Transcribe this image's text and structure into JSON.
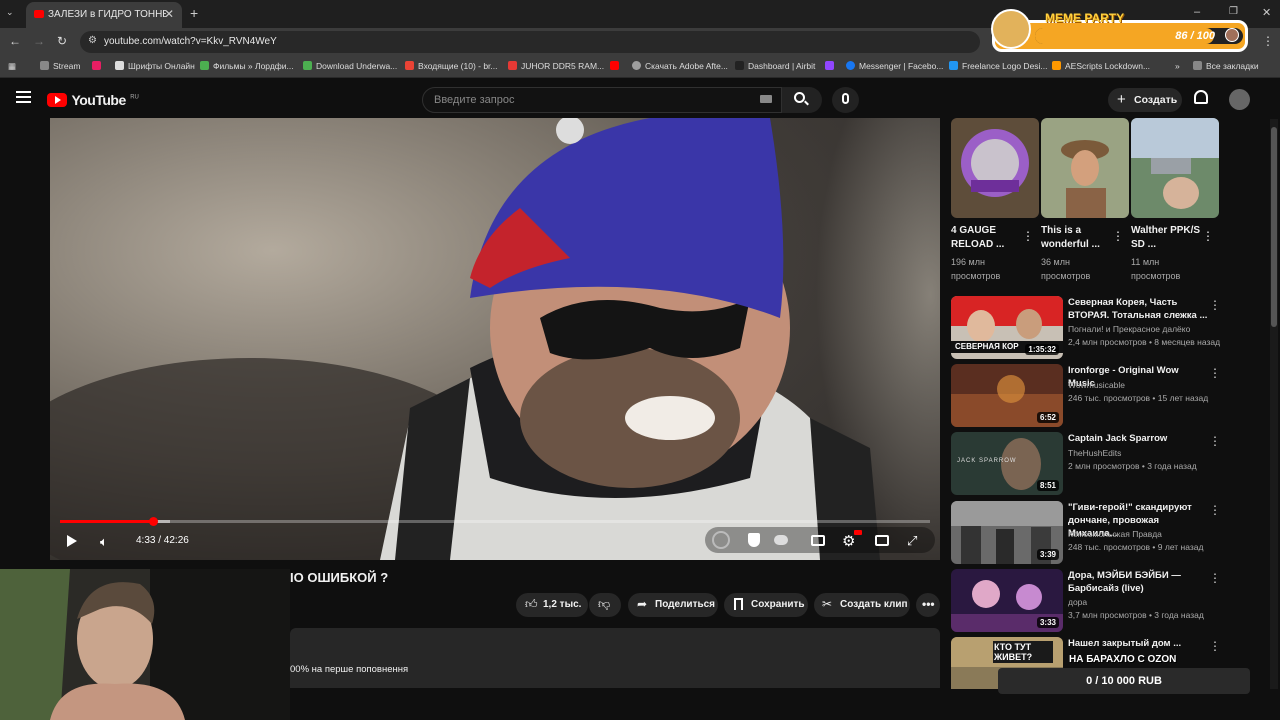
{
  "browser": {
    "tab_title": "ЗАЛЕЗИ в ГИДРО ТОННЕЛЬ ! З",
    "url": "youtube.com/watch?v=Kkv_RVN4WeY",
    "bookmarks": [
      "Stream",
      "Шрифты Онлайн",
      "Фильмы » Лордфи...",
      "Download Underwa...",
      "Входящие (10) - br...",
      "JUHOR DDR5 RAM...",
      "Скачать Adobe Afte...",
      "Dashboard | Airbit",
      "Messenger | Facebo...",
      "Freelance Logo Desi...",
      "AEScripts Lockdown...",
      "Все закладки"
    ],
    "bookmark_colors": [
      "#888",
      "#e91e63",
      "#ddd",
      "#4caf50",
      "#4caf50",
      "#ea4335",
      "#e53935",
      "#ff0000",
      "#9e9e9e",
      "#222",
      "#9146ff",
      "#1877f2",
      "#2196f3",
      "#ff9800"
    ]
  },
  "meme_widget": {
    "label": "MEME PARTY",
    "progress_text": "86 / 100",
    "progress_fraction": 0.86
  },
  "youtube": {
    "logo_text": "YouTube",
    "region": "RU",
    "search_placeholder": "Введите запрос",
    "create_label": "Создать"
  },
  "player": {
    "time": "4:33 / 42:26",
    "progress_fraction": 0.107,
    "buffer_fraction": 0.127
  },
  "video_info": {
    "title_fragment": "ІО ОШИБКОЙ ?",
    "likes": "1,2 тыс.",
    "share": "Поделиться",
    "save": "Сохранить",
    "clip": "Создать клип",
    "description_fragment": "00% на перше поповнення"
  },
  "shorts": [
    {
      "title": "4 GAUGE RELOAD ...",
      "views": "196 млн просмотров"
    },
    {
      "title": "This is a wonderful ...",
      "views": "36 млн просмотров"
    },
    {
      "title": "Walther PPK/S SD ...",
      "views": "11 млн просмотров"
    }
  ],
  "recommendations": [
    {
      "title": "Северная Корея, Часть ВТОРАЯ. Тотальная слежка ...",
      "channel": "Погнали! и Прекрасное далёко",
      "meta": "2,4 млн просмотров • 8 месяцев назад",
      "duration": "1:35:32",
      "thumb_text": "СЕВЕРНАЯ КОР"
    },
    {
      "title": "Ironforge - Original Wow Music",
      "channel": "Wowmusicable",
      "meta": "246 тыс. просмотров • 15 лет назад",
      "duration": "6:52",
      "thumb_text": ""
    },
    {
      "title": "Captain Jack Sparrow",
      "channel": "TheHushEdits",
      "meta": "2 млн просмотров • 3 года назад",
      "duration": "8:51",
      "thumb_text": "JACK SPARROW"
    },
    {
      "title": "\"Гиви-герой!\" скандируют дончане, провожая Михаила...",
      "channel": "Комсомольская Правда",
      "meta": "248 тыс. просмотров • 9 лет назад",
      "duration": "3:39",
      "thumb_text": ""
    },
    {
      "title": "Дора, МЭЙБИ БЭЙБИ — Барбисайз (live)",
      "channel": "дора",
      "meta": "3,7 млн просмотров • 3 года назад",
      "duration": "3:33",
      "thumb_text": ""
    },
    {
      "title": "Нашел закрытый дом ...",
      "channel": "",
      "meta": "",
      "duration": "",
      "thumb_text": "КТО ТУТ ЖИВЕТ?"
    }
  ],
  "overlay": {
    "barakhlo": "НА БАРАХЛО С OZON",
    "donation": "0 / 10 000 RUB"
  }
}
